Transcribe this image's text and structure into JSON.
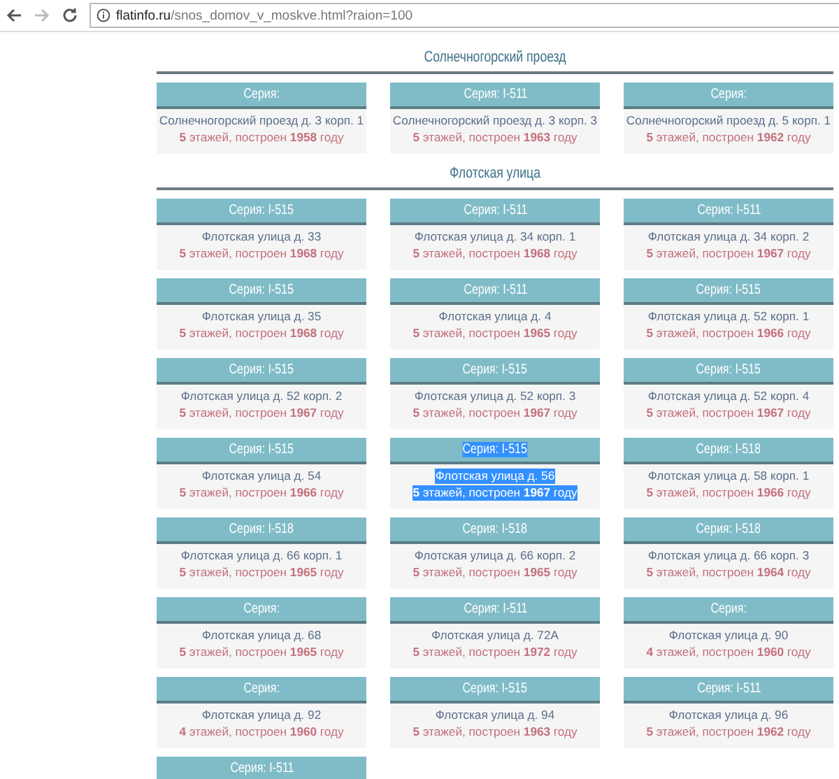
{
  "address_bar": {
    "host": "flatinfo.ru",
    "path": "/snos_domov_v_moskve.html?raion=100"
  },
  "sections": [
    {
      "title": "Солнечногорский проезд",
      "cards": [
        {
          "series": "Серия:",
          "address": "Солнечногорский проезд д. 3 корп. 1",
          "info": "**5** этажей, построен **1958** году",
          "selected": false
        },
        {
          "series": "Серия: I-511",
          "address": "Солнечногорский проезд д. 3 корп. 3",
          "info": "**5** этажей, построен **1963** году",
          "selected": false
        },
        {
          "series": "Серия:",
          "address": "Солнечногорский проезд д. 5 корп. 1",
          "info": "**5** этажей, построен **1962** году",
          "selected": false
        }
      ]
    },
    {
      "title": "Флотская улица",
      "cards": [
        {
          "series": "Серия: I-515",
          "address": "Флотская улица д. 33",
          "info": "**5** этажей, построен **1968** году",
          "selected": false
        },
        {
          "series": "Серия: I-511",
          "address": "Флотская улица д. 34 корп. 1",
          "info": "**5** этажей, построен **1968** году",
          "selected": false
        },
        {
          "series": "Серия: I-511",
          "address": "Флотская улица д. 34 корп. 2",
          "info": "**5** этажей, построен **1967** году",
          "selected": false
        },
        {
          "series": "Серия: I-515",
          "address": "Флотская улица д. 35",
          "info": "**5** этажей, построен **1968** году",
          "selected": false
        },
        {
          "series": "Серия: I-511",
          "address": "Флотская улица д. 4",
          "info": "**5** этажей, построен **1965** году",
          "selected": false
        },
        {
          "series": "Серия: I-515",
          "address": "Флотская улица д. 52 корп. 1",
          "info": "**5** этажей, построен **1966** году",
          "selected": false
        },
        {
          "series": "Серия: I-515",
          "address": "Флотская улица д. 52 корп. 2",
          "info": "**5** этажей, построен **1967** году",
          "selected": false
        },
        {
          "series": "Серия: I-515",
          "address": "Флотская улица д. 52 корп. 3",
          "info": "**5** этажей, построен **1967** году",
          "selected": false
        },
        {
          "series": "Серия: I-515",
          "address": "Флотская улица д. 52 корп. 4",
          "info": "**5** этажей, построен **1967** году",
          "selected": false
        },
        {
          "series": "Серия: I-515",
          "address": "Флотская улица д. 54",
          "info": "**5** этажей, построен **1966** году",
          "selected": false
        },
        {
          "series": "Серия: I-515",
          "address": "Флотская улица д. 56",
          "info": "**5** этажей, построен **1967** году",
          "selected": true
        },
        {
          "series": "Серия: I-518",
          "address": "Флотская улица д. 58 корп. 1",
          "info": "**5** этажей, построен **1966** году",
          "selected": false
        },
        {
          "series": "Серия: I-518",
          "address": "Флотская улица д. 66 корп. 1",
          "info": "**5** этажей, построен **1965** году",
          "selected": false
        },
        {
          "series": "Серия: I-518",
          "address": "Флотская улица д. 66 корп. 2",
          "info": "**5** этажей, построен **1965** году",
          "selected": false
        },
        {
          "series": "Серия: I-518",
          "address": "Флотская улица д. 66 корп. 3",
          "info": "**5** этажей, построен **1964** году",
          "selected": false
        },
        {
          "series": "Серия:",
          "address": "Флотская улица д. 68",
          "info": "**5** этажей, построен **1965** году",
          "selected": false
        },
        {
          "series": "Серия: I-511",
          "address": "Флотская улица д. 72А",
          "info": "**5** этажей, построен **1972** году",
          "selected": false
        },
        {
          "series": "Серия:",
          "address": "Флотская улица д. 90",
          "info": "**4** этажей, построен **1960** году",
          "selected": false
        },
        {
          "series": "Серия:",
          "address": "Флотская улица д. 92",
          "info": "**4** этажей, построен **1960** году",
          "selected": false
        },
        {
          "series": "Серия: I-515",
          "address": "Флотская улица д. 94",
          "info": "**5** этажей, построен **1963** году",
          "selected": false
        },
        {
          "series": "Серия: I-511",
          "address": "Флотская улица д. 96",
          "info": "**5** этажей, построен **1962** году",
          "selected": false
        },
        {
          "series": "Серия: I-511",
          "selected": false
        }
      ]
    }
  ]
}
